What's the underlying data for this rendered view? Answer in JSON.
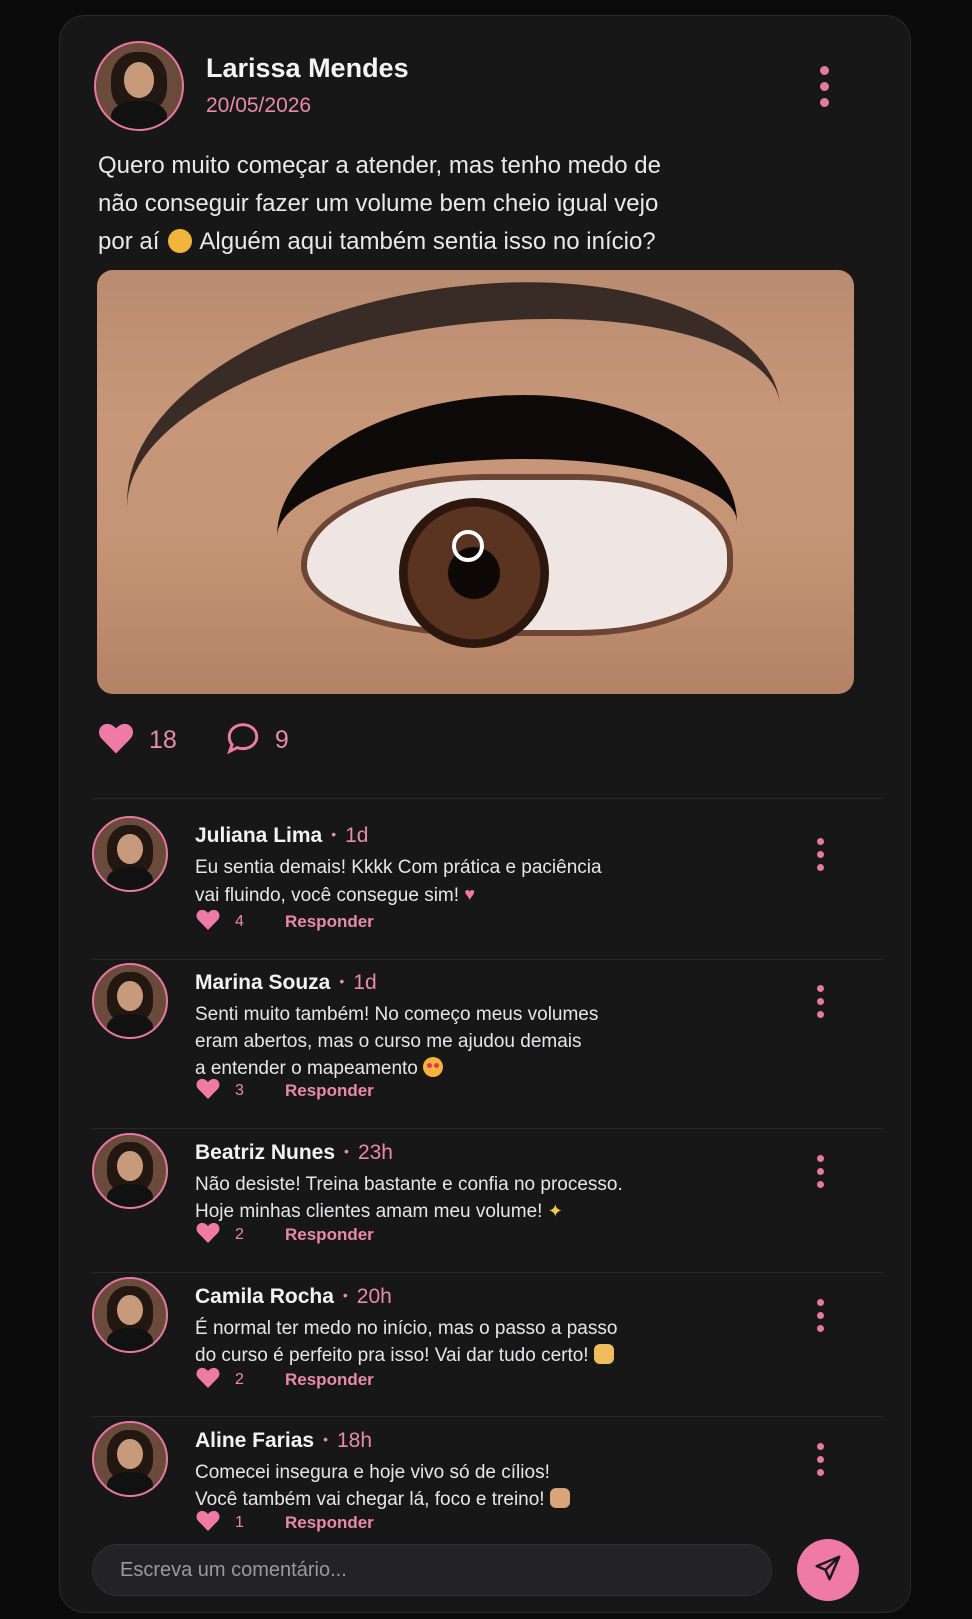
{
  "post": {
    "author": "Larissa Mendes",
    "date": "20/05/2026",
    "text_before": "Quero muito começar a atender, mas tenho medo de\nnão conseguir fazer um volume bem cheio igual vejo\npor aí",
    "text_after": "Alguém aqui também sentia isso no início?",
    "emoji_icon": "weary-face-emoji-icon",
    "likes": "18",
    "comments_count": "9"
  },
  "comments": [
    {
      "name": "Juliana Lima",
      "time": "1d",
      "text": "Eu sentia demais! Kkkk Com prática e paciência\nvai fluindo, você consegue sim!",
      "emoji": "pink-heart-emoji-icon",
      "likes": "4",
      "reply": "Responder"
    },
    {
      "name": "Marina Souza",
      "time": "1d",
      "text": "Senti muito também! No começo meus volumes\neram abertos, mas o curso me ajudou demais\na entender o mapeamento",
      "emoji": "heart-eyes-emoji-icon",
      "likes": "3",
      "reply": "Responder"
    },
    {
      "name": "Beatriz Nunes",
      "time": "23h",
      "text": "Não desiste! Treina bastante e confia no processo.\nHoje minhas clientes amam meu volume!",
      "emoji": "sparkles-emoji-icon",
      "likes": "2",
      "reply": "Responder"
    },
    {
      "name": "Camila Rocha",
      "time": "20h",
      "text": "É normal ter medo no início, mas o passo a passo\ndo curso é perfeito pra isso! Vai dar tudo certo!",
      "emoji": "raised-hands-emoji-icon",
      "likes": "2",
      "reply": "Responder"
    },
    {
      "name": "Aline Farias",
      "time": "18h",
      "text": "Comecei insegura e hoje vivo só de cílios!\nVocê também vai chegar lá, foco e treino!",
      "emoji": "flexed-biceps-emoji-icon",
      "likes": "1",
      "reply": "Responder"
    }
  ],
  "composer": {
    "placeholder": "Escreva um comentário..."
  },
  "colors": {
    "accent": "#e7789f",
    "background": "#0b0b0c",
    "card": "#171718"
  }
}
